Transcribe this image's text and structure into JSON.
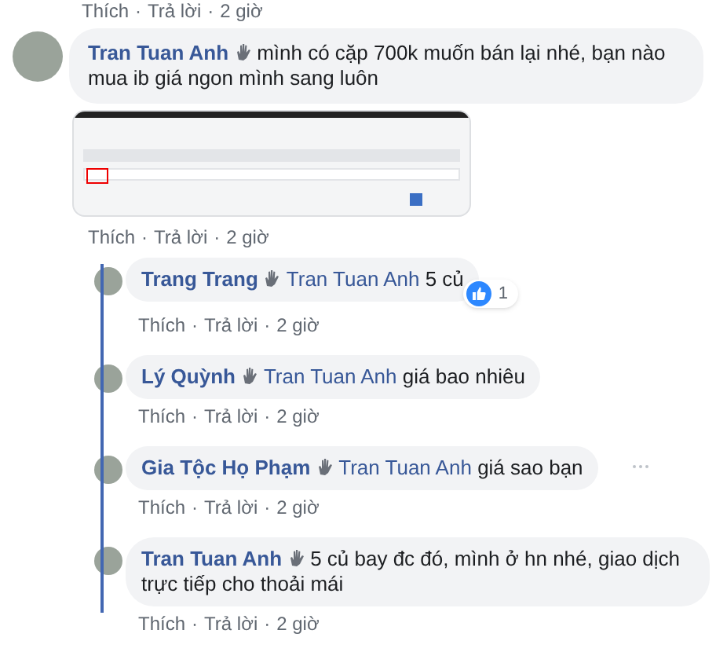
{
  "separator": "·",
  "previous_actions": {
    "like": "Thích",
    "reply": "Trả lời",
    "time": "2 giờ"
  },
  "comment": {
    "author": "Tran Tuan Anh",
    "text": "mình có cặp 700k muốn bán lại nhé, bạn nào mua ib giá ngon mình sang luôn",
    "actions": {
      "like": "Thích",
      "reply": "Trả lời",
      "time": "2 giờ"
    }
  },
  "replies": [
    {
      "author": "Trang Trang",
      "mention": "Tran Tuan Anh",
      "text": "5 củ",
      "like_count": "1",
      "more_menu": false,
      "actions": {
        "like": "Thích",
        "reply": "Trả lời",
        "time": "2 giờ"
      }
    },
    {
      "author": "Lý Quỳnh",
      "mention": "Tran Tuan Anh",
      "text": "giá bao nhiêu",
      "more_menu": false,
      "actions": {
        "like": "Thích",
        "reply": "Trả lời",
        "time": "2 giờ"
      }
    },
    {
      "author": "Gia Tộc Họ Phạm",
      "mention": "Tran Tuan Anh",
      "text": "giá sao bạn",
      "more_menu": true,
      "actions": {
        "like": "Thích",
        "reply": "Trả lời",
        "time": "2 giờ"
      }
    },
    {
      "author": "Tran Tuan Anh",
      "text": "5 củ bay đc đó, mình ở hn nhé, giao dịch trực tiếp cho thoải mái",
      "more_menu": false,
      "actions": {
        "like": "Thích",
        "reply": "Trả lời",
        "time": "2 giờ"
      }
    }
  ]
}
